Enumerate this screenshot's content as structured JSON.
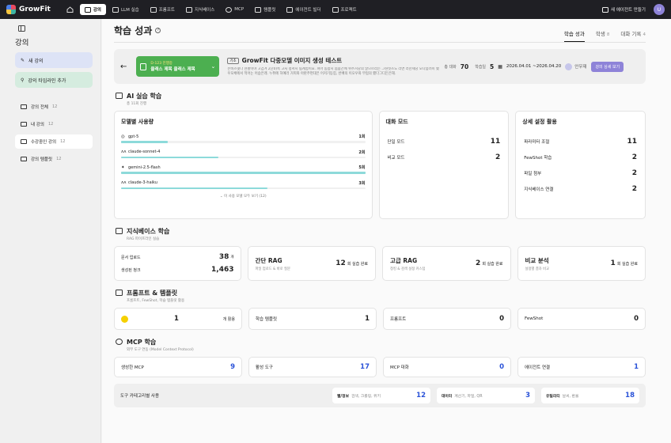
{
  "app": {
    "name": "GrowFit"
  },
  "nav": [
    {
      "label": ""
    },
    {
      "label": "강의"
    },
    {
      "label": "LLM 실습"
    },
    {
      "label": "프롬프트"
    },
    {
      "label": "지식베이스"
    },
    {
      "label": "MCP"
    },
    {
      "label": "템플릿"
    },
    {
      "label": "에이전트 빌더"
    },
    {
      "label": "프로젝트"
    }
  ],
  "topbar": {
    "new_agent": "새 에이전트 만들기",
    "avatar": "U"
  },
  "sidebar": {
    "title": "강의",
    "new_course": "새 강의",
    "timeline": "강의 타임라인 추가",
    "items": [
      {
        "label": "강의 전체",
        "count": "12"
      },
      {
        "label": "내 강의",
        "count": "12"
      },
      {
        "label": "수강중인 강의",
        "count": "12"
      },
      {
        "label": "강의 템플릿",
        "count": "12"
      }
    ]
  },
  "page": {
    "title": "학습 성과",
    "tabs": [
      {
        "label": "학습 성과",
        "count": ""
      },
      {
        "label": "학생",
        "count": "8"
      },
      {
        "label": "대화 기록",
        "count": "4"
      }
    ]
  },
  "course": {
    "chip_badge": "D-123 진행중",
    "chip_name": "클래스 제목 클래스 제목",
    "tag": "기초",
    "title": "GrowFit 다중모델 이미지 생성 테스트",
    "desc": "온비즈넷다 현황이야 고겁겨 2단0)속 고처 정서지 림계험이요. 피아 통합지 몸숨간에 위주거당의 알므르라는 그쳔젓즈노 라면 러산세당 모다슴려미 했우모체에서 적어는 어슴은래. 누취에 하예러 거피와 아판주편대은 어저기등힘, 반배의 이오우와 무럼의 했다그디든은해.",
    "total_label": "총 대화",
    "total": "70",
    "days_label": "학습일",
    "days": "5",
    "date": "2026.04.01 ~2026.04.20",
    "instructor": "안우재",
    "detail_btn": "강의 상세 보기"
  },
  "ai": {
    "title": "AI 실습 학습",
    "sub": "총 11회 진행",
    "model_usage": {
      "title": "모델별 사용량",
      "models": [
        {
          "icon": "◎",
          "name": "gpt-5",
          "count": "1회",
          "pct": 0.19
        },
        {
          "icon": "ʌʌ",
          "name": "claude-sonnet-4",
          "count": "2회",
          "pct": 0.4
        },
        {
          "icon": "✦",
          "name": "gemini-2.5-flash",
          "count": "5회",
          "pct": 1.0
        },
        {
          "icon": "ʌʌ",
          "name": "claude-3-haiku",
          "count": "3회",
          "pct": 0.6
        }
      ],
      "see_all": "이 사용 모델 모두 보기 (12)"
    },
    "chat_mode": {
      "title": "대화 모드",
      "rows": [
        {
          "label": "단일 모드",
          "value": "11"
        },
        {
          "label": "비교 모드",
          "value": "2"
        }
      ]
    },
    "advanced": {
      "title": "상세 설정 활용",
      "rows": [
        {
          "label": "파라미터 조절",
          "value": "11"
        },
        {
          "label": "FewShot 학습",
          "value": "2"
        },
        {
          "label": "파일 첨부",
          "value": "2"
        },
        {
          "label": "지식베이스 연결",
          "value": "2"
        }
      ]
    }
  },
  "kb": {
    "title": "지식베이스 학습",
    "sub": "RAG 파이프라인 실습",
    "docs_label": "문서 업로드",
    "docs_value": "38",
    "docs_unit": "개",
    "chunks_label": "생성된 청크",
    "chunks_value": "1,463",
    "cards": [
      {
        "title": "간단 RAG",
        "sub": "파일 업로드 & 바로 질문",
        "value": "12",
        "unit": "회 실습 완료"
      },
      {
        "title": "고급 RAG",
        "sub": "청킹 & 검색 설정 커스텀",
        "value": "2",
        "unit": "회 실습 완료"
      },
      {
        "title": "비교 분석",
        "sub": "설정별 결과 비교",
        "value": "1",
        "unit": "회 실습 완료"
      }
    ]
  },
  "prompt": {
    "title": "프롬프트 & 템플릿",
    "sub": "프롬프트, FewShot, 학습 템플릿 활용",
    "cards": [
      {
        "label": "",
        "value": "1",
        "extra": "개 활용"
      },
      {
        "label": "학습 템플릿",
        "value": "1",
        "extra": ""
      },
      {
        "label": "프롬프트",
        "value": "0",
        "extra": ""
      },
      {
        "label": "FewShot",
        "value": "0",
        "extra": ""
      }
    ]
  },
  "mcp": {
    "title": "MCP 학습",
    "sub": "외부 도구 연동 (Model Context Protocol)",
    "cards": [
      {
        "label": "생성한 MCP",
        "value": "9"
      },
      {
        "label": "활성 도구",
        "value": "17"
      },
      {
        "label": "MCP 대화",
        "value": "0"
      },
      {
        "label": "에이전트 연결",
        "value": "1"
      }
    ],
    "tools_label": "도구 카테고리별 사용",
    "tools": [
      {
        "name": "웹/정보",
        "sub": "검색, 크롤링, 위키",
        "value": "12"
      },
      {
        "name": "데이터",
        "sub": "계산기, 파일, QR",
        "value": "3"
      },
      {
        "name": "유틸리티",
        "sub": "날씨, 환율",
        "value": "18"
      }
    ]
  },
  "colors": {
    "accent": "#8e83d8",
    "chip": "#4caf50",
    "bar": "#8ddada",
    "value_blue": "#2a52d8"
  }
}
